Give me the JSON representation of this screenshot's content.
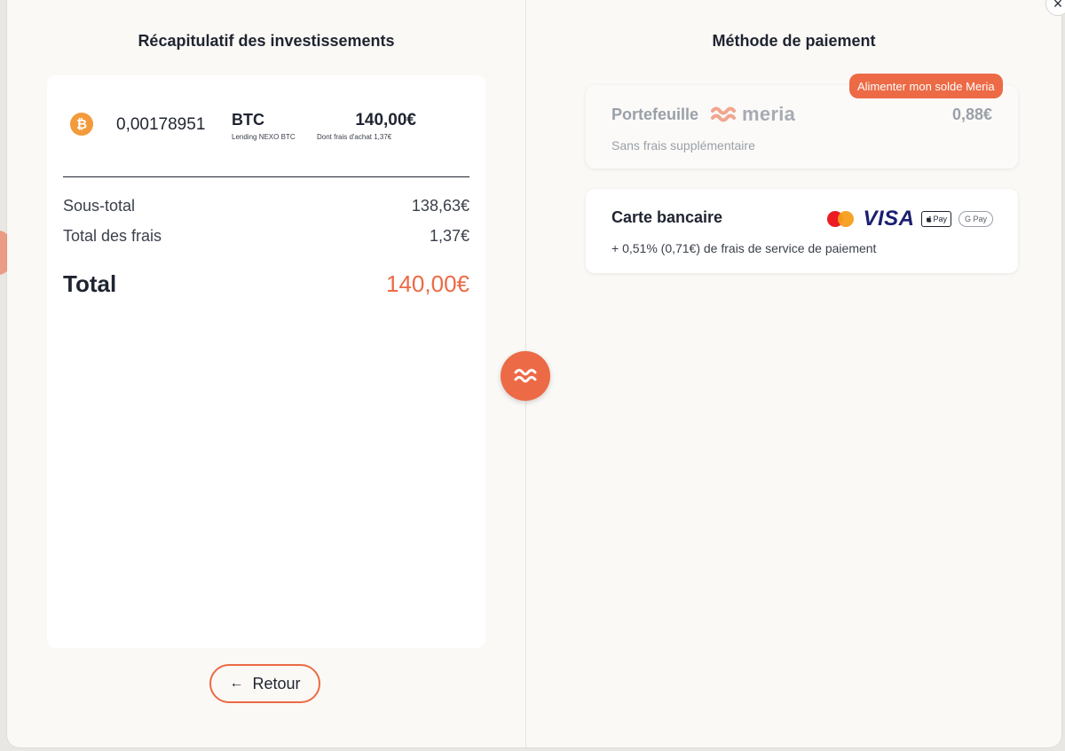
{
  "summary": {
    "title": "Récapitulatif des investissements",
    "asset": {
      "icon": "bitcoin-icon",
      "icon_glyph": "₿",
      "quantity": "0,00178951",
      "symbol": "BTC",
      "product": "Lending NEXO BTC",
      "amount": "140,00€",
      "fees_note": "Dont frais d'achat 1,37€"
    },
    "subtotal_label": "Sous-total",
    "subtotal_value": "138,63€",
    "fees_label": "Total des frais",
    "fees_value": "1,37€",
    "total_label": "Total",
    "total_value": "140,00€"
  },
  "back_button": {
    "arrow": "←",
    "label": "Retour"
  },
  "payment": {
    "title": "Méthode de paiement",
    "wallet": {
      "badge": "Alimenter mon solde Meria",
      "label": "Portefeuille",
      "brand": "meria",
      "balance": "0,88€",
      "subtitle": "Sans frais supplémentaire"
    },
    "card": {
      "label": "Carte bancaire",
      "visa": "VISA",
      "apple_pay": "Pay",
      "google_pay": "G Pay",
      "subtitle": "+ 0,51% (0,71€) de frais de service de paiement"
    }
  },
  "close_glyph": "×",
  "colors": {
    "accent": "#ec6a45",
    "text": "#1f2430",
    "muted": "#9aa0a8",
    "bitcoin": "#f39a3b"
  }
}
